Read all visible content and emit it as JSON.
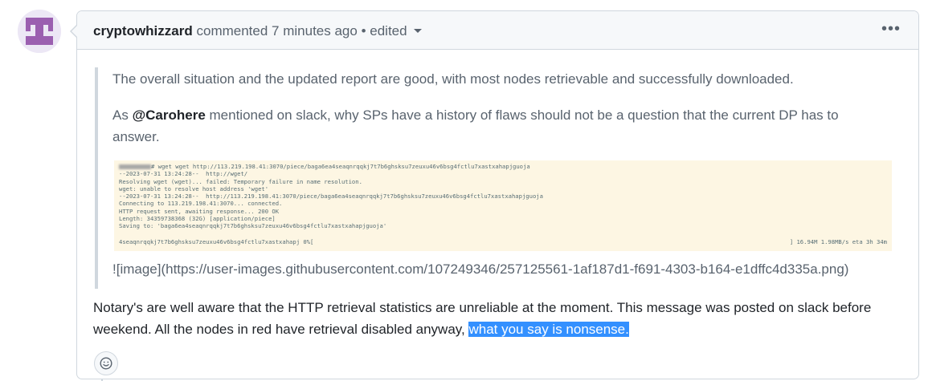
{
  "comment": {
    "author": "cryptowhizzard",
    "action": "commented",
    "time": "7 minutes ago",
    "separator": "•",
    "edited": "edited",
    "menu_icon": "kebab-horizontal-icon",
    "quote": {
      "paragraph1": "The overall situation and the updated report are good, with most nodes retrievable and successfully downloaded.",
      "paragraph2_prefix": "As ",
      "mention": "@Carohere",
      "paragraph2_suffix": " mentioned on slack, why SPs have a history of flaws should not be a question that the current DP has to answer.",
      "terminal_lines": [
        "# wget wget http://113.219.198.41:3070/piece/baga6ea4seaqnrqqkj7t7b6ghsksu7zeuxu46v6bsg4fctlu7xastxahapjguoja",
        "--2023-07-31 13:24:28--  http://wget/",
        "Resolving wget (wget)... failed: Temporary failure in name resolution.",
        "wget: unable to resolve host address 'wget'",
        "--2023-07-31 13:24:28--  http://113.219.198.41:3070/piece/baga6ea4seaqnrqqkj7t7b6ghsksu7zeuxu46v6bsg4fctlu7xastxahapjguoja",
        "Connecting to 113.219.198.41:3070... connected.",
        "HTTP request sent, awaiting response... 200 OK",
        "Length: 34359738368 (32G) [application/piece]",
        "Saving to: 'baga6ea4seaqnrqqkj7t7b6ghsksu7zeuxu46v6bsg4fctlu7xastxahapjguoja'"
      ],
      "terminal_progress_left": "4seaqnrqqkj7t7b6ghsksu7zeuxu46v6bsg4fctlu7xastxahapj   0%[",
      "terminal_progress_right": "]  16.94M  1.98MB/s    eta 3h 34m",
      "image_markdown": "![image](https://user-images.githubusercontent.com/107249346/257125561-1af187d1-f691-4303-b164-e1dffc4d335a.png)"
    },
    "body_plain": "Notary's are well aware that the HTTP retrieval statistics are unreliable at the moment. This message was posted on slack before weekend. All the nodes in red have retrieval disabled anyway, ",
    "body_highlight": "what you say is nonsense.",
    "reaction_icon": "smiley-icon"
  },
  "colors": {
    "avatar_bg": "#ece7f5",
    "avatar_fg": "#9b5fb0",
    "terminal_bg": "#fdf6e3",
    "selection": "#3390ff"
  }
}
